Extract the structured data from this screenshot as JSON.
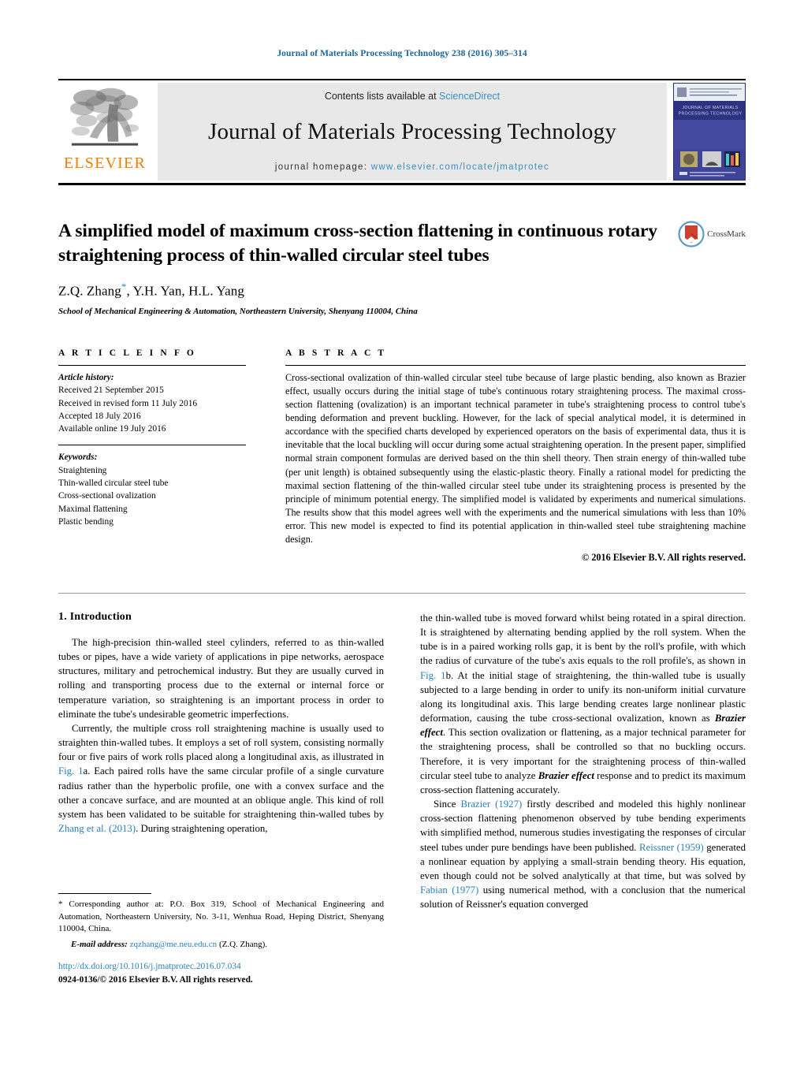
{
  "running_head": "Journal of Materials Processing Technology 238 (2016) 305–314",
  "masthead": {
    "publisher_name": "ELSEVIER",
    "contents_prefix": "Contents lists available at ",
    "sciencedirect": "ScienceDirect",
    "journal_title": "Journal of Materials Processing Technology",
    "homepage_label": "journal homepage:",
    "homepage_url": "www.elsevier.com/locate/jmatprotec",
    "cover_line1": "JOURNAL OF MATERIALS",
    "cover_line2": "PROCESSING TECHNOLOGY"
  },
  "title": {
    "text": "A simplified model of maximum cross-section flattening in continuous rotary straightening process of thin-walled circular steel tubes",
    "crossmark_label": "CrossMark"
  },
  "authors": {
    "list": "Z.Q. Zhang",
    "rest": ", Y.H. Yan, H.L. Yang",
    "affiliation": "School of Mechanical Engineering & Automation, Northeastern University, Shenyang 110004, China"
  },
  "article_info": {
    "heading": "A R T I C L E   I N F O",
    "history_label": "Article history:",
    "history": [
      "Received 21 September 2015",
      "Received in revised form 11 July 2016",
      "Accepted 18 July 2016",
      "Available online 19 July 2016"
    ],
    "keywords_label": "Keywords:",
    "keywords": [
      "Straightening",
      "Thin-walled circular steel tube",
      "Cross-sectional ovalization",
      "Maximal flattening",
      "Plastic bending"
    ]
  },
  "abstract": {
    "heading": "A B S T R A C T",
    "text": "Cross-sectional ovalization of thin-walled circular steel tube because of large plastic bending, also known as Brazier effect, usually occurs during the initial stage of tube's continuous rotary straightening process. The maximal cross-section flattening (ovalization) is an important technical parameter in tube's straightening process to control tube's bending deformation and prevent buckling. However, for the lack of special analytical model, it is determined in accordance with the specified charts developed by experienced operators on the basis of experimental data, thus it is inevitable that the local buckling will occur during some actual straightening operation. In the present paper, simplified normal strain component formulas are derived based on the thin shell theory. Then strain energy of thin-walled tube (per unit length) is obtained subsequently using the elastic-plastic theory. Finally a rational model for predicting the maximal section flattening of the thin-walled circular steel tube under its straightening process is presented by the principle of minimum potential energy. The simplified model is validated by experiments and numerical simulations. The results show that this model agrees well with the experiments and the numerical simulations with less than 10% error. This new model is expected to find its potential application in thin-walled steel tube straightening machine design.",
    "copyright": "© 2016 Elsevier B.V. All rights reserved."
  },
  "body": {
    "section_heading": "1.  Introduction",
    "left_para1": "The high-precision thin-walled steel cylinders, referred to as thin-walled tubes or pipes, have a wide variety of applications in pipe networks, aerospace structures, military and petrochemical industry. But they are usually curved in rolling and transporting process due to the external or internal force or temperature variation, so straightening is an important process in order to eliminate the tube's undesirable geometric imperfections.",
    "left_para2_a": "Currently, the multiple cross roll straightening machine is usually used to straighten thin-walled tubes. It employs a set of roll system, consisting normally four or five pairs of work rolls placed along a longitudinal axis, as illustrated in ",
    "left_ref_fig1a": "Fig. 1",
    "left_para2_b": "a. Each paired rolls have the same circular profile of a single curvature radius rather than the hyperbolic profile, one with a convex surface and the other a concave surface, and are mounted at an oblique angle. This kind of roll system has been validated to be suitable for straightening thin-walled tubes by ",
    "left_ref_zhang": "Zhang et al. (2013)",
    "left_para2_c": ". During straightening operation,",
    "right_para1_a": "the thin-walled tube is moved forward whilst being rotated in a spiral direction. It is straightened by alternating bending applied by the roll system. When the tube is in a paired working rolls gap, it is bent by the roll's profile, with which the radius of curvature of the tube's axis equals to the roll profile's, as shown in ",
    "right_ref_fig1b": "Fig. 1",
    "right_para1_b": "b. At the initial stage of straightening, the thin-walled tube is usually subjected to a large bending in order to unify its non-uniform initial curvature along its longitudinal axis. This large bending creates large nonlinear plastic deformation, causing the tube cross-sectional ovalization, known as ",
    "right_bi_1": "Brazier effect",
    "right_para1_c": ". This section ovalization or flattening, as a major technical parameter for the straightening process, shall be controlled so that no buckling occurs. Therefore, it is very important for the straightening process of thin-walled circular steel tube to analyze ",
    "right_bi_2": "Brazier effect",
    "right_para1_d": " response and to predict its maximum cross-section flattening accurately.",
    "right_para2_a": "Since ",
    "right_ref_brazier": "Brazier (1927)",
    "right_para2_b": " firstly described and modeled this highly nonlinear cross-section flattening phenomenon observed by tube bending experiments with simplified method, numerous studies investigating the responses of circular steel tubes under pure bendings have been published. ",
    "right_ref_reissner": "Reissner (1959)",
    "right_para2_c": " generated a nonlinear equation by applying a small-strain bending theory. His equation, even though could not be solved analytically at that time, but was solved by ",
    "right_ref_fabian": "Fabian (1977)",
    "right_para2_d": " using numerical method, with a conclusion that the numerical solution of Reissner's equation converged"
  },
  "footnote": {
    "text": "* Corresponding author at: P.O. Box 319, School of Mechanical Engineering and Automation, Northeastern University, No. 3-11, Wenhua Road, Heping District, Shenyang 110004, China.",
    "email_label": "E-mail address:",
    "email": "zqzhang@me.neu.edu.cn",
    "email_suffix": "(Z.Q. Zhang)."
  },
  "doi": {
    "url": "http://dx.doi.org/10.1016/j.jmatprotec.2016.07.034",
    "issn_line": "0924-0136/© 2016 Elsevier B.V. All rights reserved."
  },
  "colors": {
    "link": "#2a7fb8",
    "elsevier_orange": "#ef7d00",
    "sciencedirect_blue": "#3a8fc0",
    "running_head": "#1a6496"
  }
}
